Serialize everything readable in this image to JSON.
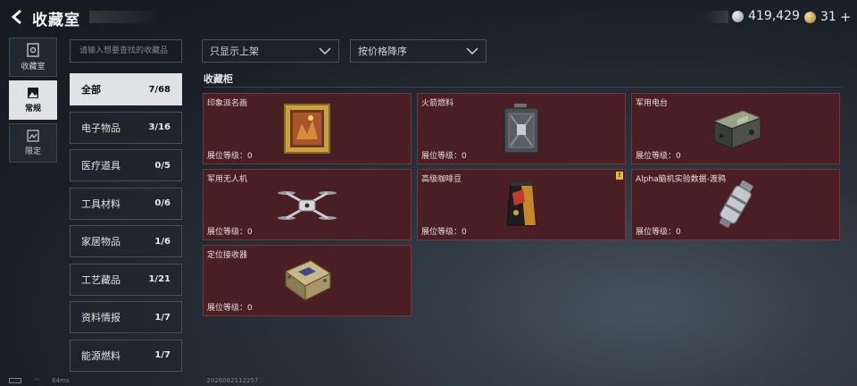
{
  "header": {
    "title": "收藏室",
    "currency_silver": "419,429",
    "currency_gold": "31",
    "plus": "+"
  },
  "leftnav": [
    {
      "label": "收藏室",
      "icon": "vault-icon",
      "active": false
    },
    {
      "label": "常规",
      "icon": "picture-icon",
      "active": true
    },
    {
      "label": "限定",
      "icon": "limited-icon",
      "active": false
    }
  ],
  "search": {
    "placeholder": "请输入想要查找的收藏品"
  },
  "filters": {
    "shelf": "只显示上架",
    "sort": "按价格降序"
  },
  "categories": [
    {
      "name": "全部",
      "count": "7/68",
      "active": true
    },
    {
      "name": "电子物品",
      "count": "3/16"
    },
    {
      "name": "医疗道具",
      "count": "0/5"
    },
    {
      "name": "工具材料",
      "count": "0/6"
    },
    {
      "name": "家居物品",
      "count": "1/6"
    },
    {
      "name": "工艺藏品",
      "count": "1/21"
    },
    {
      "name": "资料情报",
      "count": "1/7"
    },
    {
      "name": "能源燃料",
      "count": "1/7"
    }
  ],
  "section": {
    "title": "收藏柜"
  },
  "items": [
    {
      "name": "印象派名画",
      "level": "展位等级：0",
      "icon": "painting-icon",
      "badge": ""
    },
    {
      "name": "火箭燃料",
      "level": "展位等级：0",
      "icon": "fuel-canister-icon",
      "badge": ""
    },
    {
      "name": "军用电台",
      "level": "展位等级：0",
      "icon": "radio-icon",
      "badge": ""
    },
    {
      "name": "军用无人机",
      "level": "展位等级：0",
      "icon": "drone-icon",
      "badge": ""
    },
    {
      "name": "高级咖啡豆",
      "level": "展位等级：0",
      "icon": "coffee-bag-icon",
      "badge": "!"
    },
    {
      "name": "Alpha脑机实验数据-渡鸦",
      "level": "展位等级：0",
      "icon": "data-canister-icon",
      "badge": ""
    },
    {
      "name": "定位接收器",
      "level": "展位等级：0",
      "icon": "receiver-icon",
      "badge": ""
    }
  ],
  "footer": {
    "ping": "64ms",
    "build": "2026062112257"
  }
}
